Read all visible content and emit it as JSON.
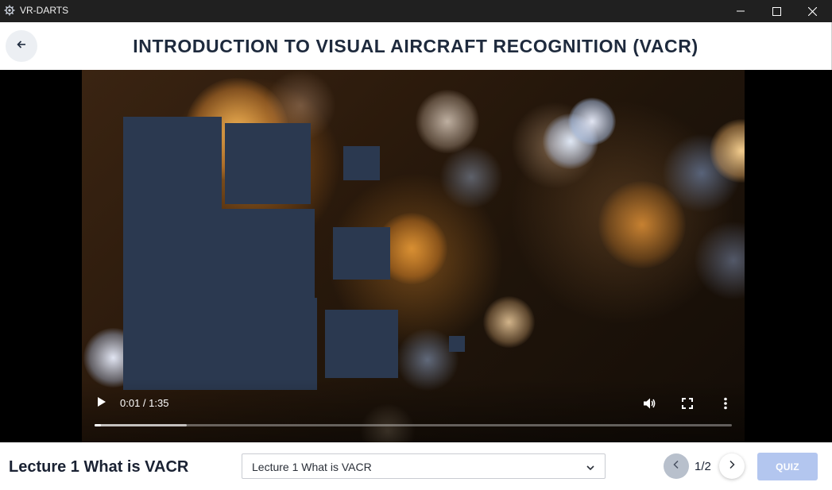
{
  "window": {
    "app_title": "VR-DARTS",
    "app_icon": "gear-icon",
    "controls": [
      "minimize-icon",
      "maximize-icon",
      "close-icon"
    ]
  },
  "header": {
    "back_icon": "arrow-left-icon",
    "title": "INTRODUCTION TO VISUAL AIRCRAFT RECOGNITION (VACR)"
  },
  "video": {
    "time_display": "0:01 / 1:35",
    "played_fraction": 0.0105,
    "buffered_fraction": 0.145,
    "icons": {
      "play": "play-icon",
      "volume": "volume-icon",
      "fullscreen": "fullscreen-icon",
      "more": "more-vertical-icon"
    }
  },
  "footer": {
    "lecture_title": "Lecture 1 What is VACR",
    "selected_lecture": "Lecture 1 What is VACR",
    "pager": {
      "current": 1,
      "total": 2,
      "label": "1/2",
      "prev_icon": "chevron-left-icon",
      "next_icon": "chevron-right-icon"
    },
    "quiz_label": "QUIZ"
  },
  "colors": {
    "titlebar": "#202020",
    "title_text": "#1e2a3d",
    "redaction_block": "#2b3950",
    "quiz_button": "#b3c6ef",
    "pager_prev": "#b8c0cc"
  }
}
